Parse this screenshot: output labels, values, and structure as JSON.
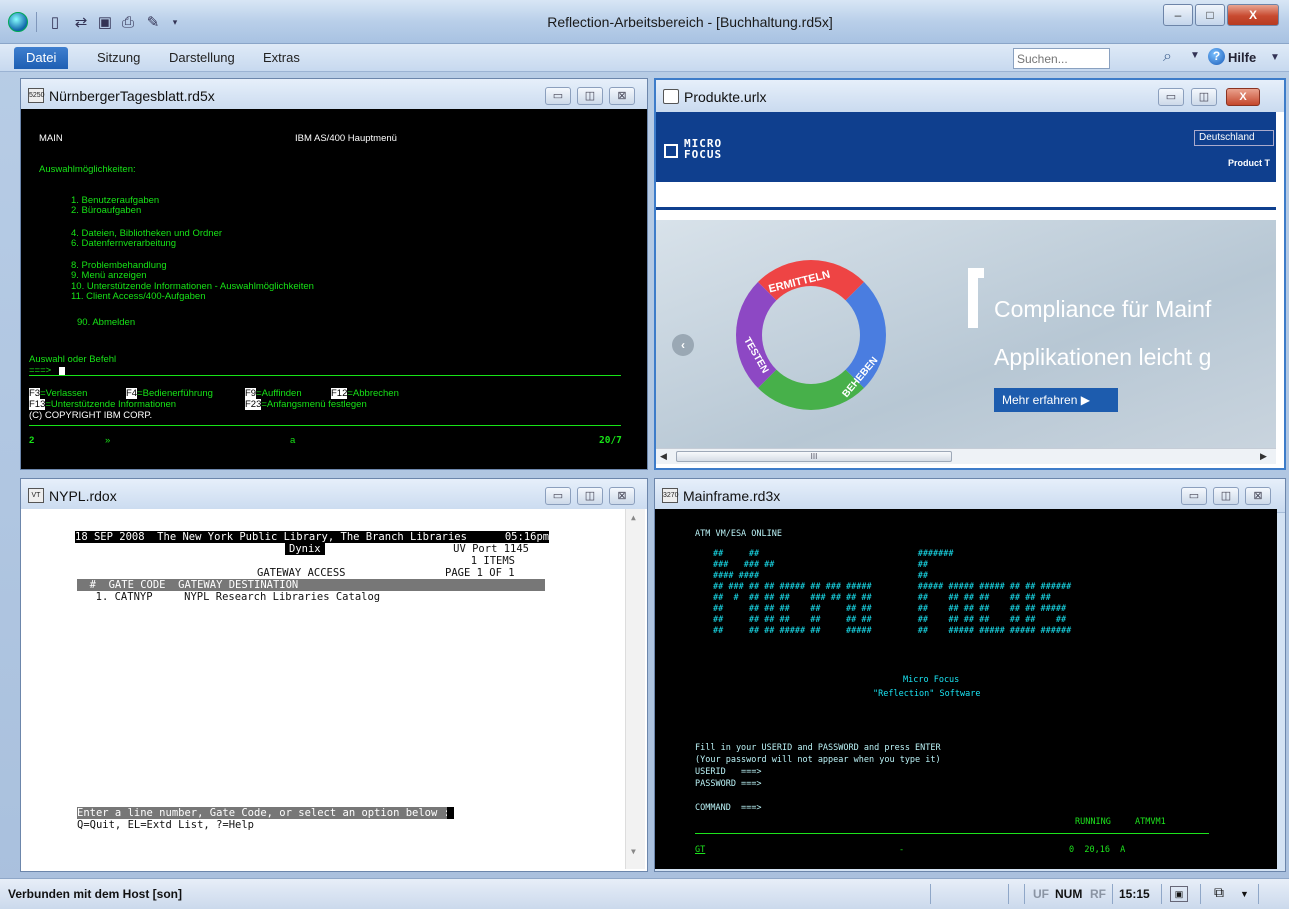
{
  "window": {
    "title": "Reflection-Arbeitsbereich - [Buchhaltung.rd5x]",
    "min": "–",
    "max": "□",
    "close": "X"
  },
  "ribbon": {
    "tabs": [
      "Datei",
      "Sitzung",
      "Darstellung",
      "Extras"
    ],
    "search_placeholder": "Suchen...",
    "help_label": "Hilfe"
  },
  "icons": {
    "app": "app-orb-icon",
    "new": "new-document-icon",
    "open": "open-icon",
    "save": "save-icon",
    "print": "print-icon",
    "edit": "edit-macro-icon",
    "search": "search-icon",
    "help": "help-icon"
  },
  "child_windows": {
    "nuernberg": {
      "title": "NürnbergerTagesblatt.rd5x",
      "icon_text": "5250"
    },
    "produkte": {
      "title": "Produkte.urlx"
    },
    "nypl": {
      "title": "NYPL.rdox",
      "icon_text": "VT"
    },
    "mainframe": {
      "title": "Mainframe.rd3x",
      "icon_text": "3270"
    }
  },
  "as400": {
    "main": "MAIN",
    "header": "IBM AS/400 Hauptmenü",
    "choices": "Auswahlmöglichkeiten:",
    "items": [
      "1. Benutzeraufgaben",
      "2. Büroaufgaben",
      "4. Dateien, Bibliotheken und Ordner",
      "6. Datenfernverarbeitung",
      "8. Problembehandlung",
      "9. Menü anzeigen",
      "10. Unterstützende Informationen - Auswahlmöglichkeiten",
      "11. Client Access/400-Aufgaben",
      "90. Abmelden"
    ],
    "prompt": "Auswahl oder Befehl",
    "arrow": "===>",
    "fkeys": {
      "f3": "F3",
      "f3_label": "=Verlassen",
      "f4": "F4",
      "f4_label": "=Bedienerführung",
      "f9": "F9",
      "f9_label": "=Auffinden",
      "f12": "F12",
      "f12_label": "=Abbrechen",
      "f13": "F13",
      "f13_label": "=Unterstützende Informationen",
      "f23": "F23",
      "f23_label": "=Anfangsmenü festlegen"
    },
    "copyright": "(C) COPYRIGHT IBM CORP.",
    "status_left": "2",
    "status_mid1": "»",
    "status_mid2": "a",
    "status_right": "20/7"
  },
  "web": {
    "logo_line1": "MICRO",
    "logo_line2": "FOCUS",
    "country": "Deutschland",
    "product_link": "Product T",
    "banner_line1": "Compliance für Mainf",
    "banner_line2": "Applikationen leicht g",
    "cta": "Mehr erfahren ▶",
    "ring_labels": [
      "ERMITTELN",
      "BEHEBEN",
      "TESTEN"
    ],
    "scroll_grip": "III"
  },
  "nypl_screen": {
    "l1": "18 SEP 2008  The New York Public Library, The Branch Libraries      05:16pm",
    "dynix": "Dynix",
    "port": "UV Port 1145",
    "items": "1 ITEMS",
    "gateway": "GATEWAY ACCESS",
    "page": "PAGE 1 OF 1",
    "colhead": "  #  GATE CODE  GATEWAY DESTINATION                                       ",
    "row1": "  1. CATNYP     NYPL Research Libraries Catalog",
    "prompt": "Enter a line number, Gate Code, or select an option below :",
    "options": "Q=Quit, EL=Extd List, ?=Help"
  },
  "mf_screen": {
    "header": "ATM VM/ESA ONLINE",
    "art": [
      "##     ##                               #######",
      "###   ### ##                            ##",
      "#### ####                               ##",
      "## ### ## ## ##### ## ### #####         ##### ##### ##### ## ## ######",
      "##  #  ## ## ##    ### ## ## ##         ##    ## ## ##    ## ## ##",
      "##     ## ## ##    ##     ## ##         ##    ## ## ##    ## ## #####",
      "##     ## ## ##    ##     ## ##         ##    ## ## ##    ## ##    ##",
      "##     ## ## ##### ##     #####         ##    ##### ##### ##### ######"
    ],
    "company": "Micro Focus",
    "product": "\"Reflection\" Software",
    "fill1": "Fill in your USERID and PASSWORD and press ENTER",
    "fill2": "(Your password will not appear when you type it)",
    "userid": "USERID   ===>",
    "password": "PASSWORD ===>",
    "command": "COMMAND  ===>",
    "running": "RUNNING",
    "host": "ATMVM1",
    "status_left": "GT",
    "status_mid": "-",
    "status_right": "0  20,16  A"
  },
  "status": {
    "text": "Verbunden mit dem Host [son]",
    "uf": "UF",
    "num": "NUM",
    "rf": "RF",
    "time": "15:15"
  }
}
